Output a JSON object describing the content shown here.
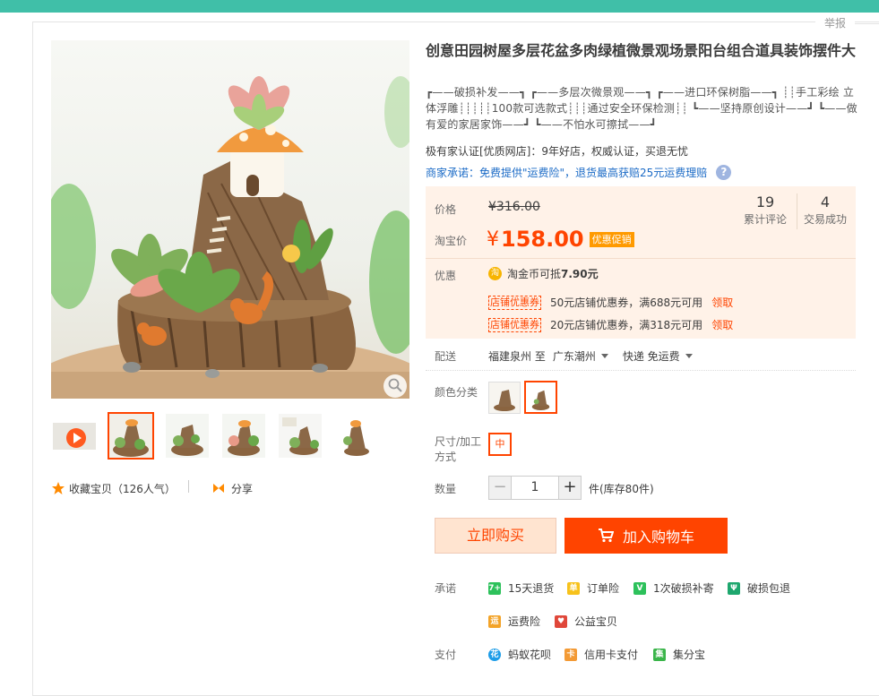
{
  "report_label": "举报",
  "product": {
    "title": "创意田园树屋多层花盆多肉绿植微景观场景阳台组合道具装饰摆件大",
    "subtitle": "┏——破损补发——┓ ┏——多层次微景观——┓ ┏——进口环保树脂——┓ ┊┊手工彩绘 立体浮雕┊┊┊┊┊100款可选款式┊┊┊通过安全环保检测┊┊ ┗——坚持原创设计——┛ ┗——做有爱的家居家饰——┛ ┗——不怕水可擦拭——┛",
    "certification": "极有家认证[优质网店]：9年好店，权威认证，买退无忧",
    "merchant_promise": "商家承诺：免费提供\"运费险\"，退货最高获赔25元运费理赔",
    "help_icon": "question-icon"
  },
  "gallery": {
    "thumbnails": [
      "video",
      "tree-house-1",
      "tree-house-2",
      "tree-house-3",
      "tree-house-4",
      "tree-house-5"
    ],
    "active_index": 1,
    "collect_label": "收藏宝贝（126人气）",
    "share_label": "分享"
  },
  "price": {
    "original_label": "价格",
    "original_value": "¥316.00",
    "taobao_label": "淘宝价",
    "currency": "¥",
    "value": "158.00",
    "promo_tag": "优惠促销",
    "reviews_count": "19",
    "reviews_label": "累计评论",
    "deals_count": "4",
    "deals_label": "交易成功"
  },
  "discount": {
    "label": "优惠",
    "coin_icon": "淘",
    "coin_text": "淘金币可抵",
    "coin_amount": "7.90元",
    "coupons": [
      {
        "tag": "店铺优惠券",
        "text": "50元店铺优惠券，满688元可用",
        "action": "领取"
      },
      {
        "tag": "店铺优惠券",
        "text": "20元店铺优惠券，满318元可用",
        "action": "领取"
      }
    ]
  },
  "shipping": {
    "label": "配送",
    "from": "福建泉州 至",
    "to": "广东潮州",
    "method": "快递 免运费"
  },
  "sku": {
    "color_label": "颜色分类",
    "size_label": "尺寸/加工方式",
    "size_option": "中",
    "qty_label": "数量",
    "qty_value": "1",
    "stock": "件(库存80件)"
  },
  "actions": {
    "buy": "立即购买",
    "cart": "加入购物车"
  },
  "services": {
    "promise_label": "承诺",
    "pay_label": "支付",
    "promise_items": [
      {
        "icon": "7+",
        "text": "15天退货",
        "color": "#2dc15b"
      },
      {
        "icon": "单",
        "text": "订单险",
        "color": "#f7c21b"
      },
      {
        "icon": "V",
        "text": "1次破损补寄",
        "color": "#2dc15b"
      },
      {
        "icon": "Ψ",
        "text": "破损包退",
        "color": "#1ea76e"
      },
      {
        "icon": "运",
        "text": "运费险",
        "color": "#f3a328"
      },
      {
        "icon": "♥",
        "text": "公益宝贝",
        "color": "#e0473a"
      }
    ],
    "pay_items": [
      {
        "icon": "花",
        "text": "蚂蚁花呗",
        "color": "#1e9de8"
      },
      {
        "icon": "卡",
        "text": "信用卡支付",
        "color": "#f39a35"
      },
      {
        "icon": "集",
        "text": "集分宝",
        "color": "#3ab54a"
      }
    ]
  },
  "colors": {
    "accent": "#ff4400",
    "topbar": "#40bfa8",
    "price_bg": "#fff2e8"
  }
}
